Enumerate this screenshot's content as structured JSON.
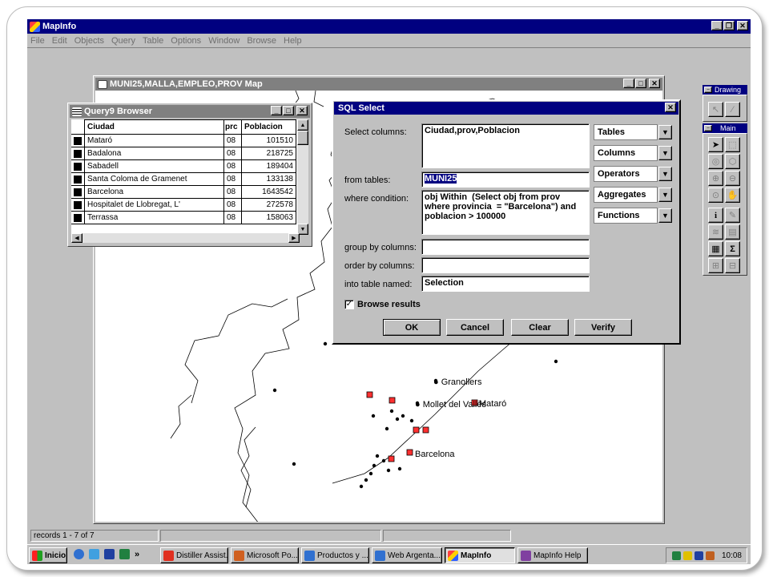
{
  "app": {
    "title": "MapInfo",
    "menu": [
      "File",
      "Edit",
      "Objects",
      "Query",
      "Table",
      "Options",
      "Window",
      "Browse",
      "Help"
    ]
  },
  "map_window": {
    "title": "MUNI25,MALLA,EMPLEO,PROV Map",
    "labels": {
      "granollers": "Granollers",
      "mollet": "Mollet del Vallès",
      "mataro": "Mataró",
      "barcelona": "Barcelona"
    }
  },
  "browser": {
    "title": "Query9 Browser",
    "columns": [
      "Ciudad",
      "prc",
      "Poblacion"
    ],
    "rows": [
      {
        "ciudad": "Mataró",
        "prov": "08",
        "poblacion": "101510"
      },
      {
        "ciudad": "Badalona",
        "prov": "08",
        "poblacion": "218725"
      },
      {
        "ciudad": "Sabadell",
        "prov": "08",
        "poblacion": "189404"
      },
      {
        "ciudad": "Santa Coloma de Gramenet",
        "prov": "08",
        "poblacion": "133138"
      },
      {
        "ciudad": "Barcelona",
        "prov": "08",
        "poblacion": "1643542"
      },
      {
        "ciudad": "Hospitalet de Llobregat, L'",
        "prov": "08",
        "poblacion": "272578"
      },
      {
        "ciudad": "Terrassa",
        "prov": "08",
        "poblacion": "158063"
      }
    ]
  },
  "sql_dialog": {
    "title": "SQL Select",
    "labels": {
      "select_columns": "Select columns:",
      "from_tables": "from tables:",
      "where_condition": "where condition:",
      "group_by": "group by columns:",
      "order_by": "order by columns:",
      "into_table": "into table named:",
      "browse_results": "Browse results"
    },
    "values": {
      "select_columns": "Ciudad,prov,Poblacion",
      "from_tables": "MUNI25",
      "where_condition": "obj Within  (Select obj from prov where provincia  = \"Barcelona\") and poblacion > 100000",
      "group_by": "",
      "order_by": "",
      "into_table": "Selection",
      "browse_results_checked": true
    },
    "dropdowns": [
      "Tables",
      "Columns",
      "Operators",
      "Aggregates",
      "Functions"
    ],
    "buttons": {
      "ok": "OK",
      "cancel": "Cancel",
      "clear": "Clear",
      "verify": "Verify"
    }
  },
  "palettes": {
    "drawing": "Drawing",
    "main": "Main"
  },
  "status": {
    "records": "records 1 - 7 of 7"
  },
  "taskbar": {
    "start": "Inicio",
    "chevron": "»",
    "items": [
      "Distiller Assist...",
      "Microsoft Po...",
      "Productos y ...",
      "Web Argenta...",
      "MapInfo",
      "MapInfo Help"
    ],
    "active_index": 4,
    "clock": "10:08"
  }
}
